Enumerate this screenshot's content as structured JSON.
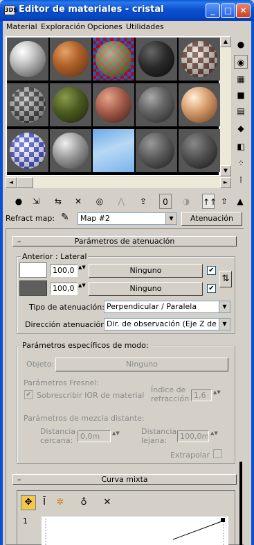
{
  "window": {
    "title": "Editor de materiales - cristal",
    "app_icon": "3DS",
    "min": "_",
    "max": "□",
    "close": "✕"
  },
  "menu": [
    "Material",
    "Exploración",
    "Opciones",
    "Utilidades"
  ],
  "icons": {
    "scroll_up": "▲",
    "scroll_down": "▼",
    "scroll_left": "◄",
    "scroll_right": "►",
    "dropdown_arrow": "▼",
    "spin": "▲▼",
    "check": "✔",
    "minus": "–"
  },
  "side_tools": [
    "●",
    "◉",
    "▦",
    "■",
    "▤",
    "◆",
    "◧",
    "⁘",
    "⁞"
  ],
  "toolbar": [
    "●",
    "⇲",
    "⇆",
    "✕",
    "◎",
    "⋀",
    "⇪",
    "0",
    "◑",
    "↑↑",
    "⇧",
    "▲"
  ],
  "refract": {
    "label": "Refract map:",
    "map": "Map #2",
    "button": "Atenuación"
  },
  "rollout1": {
    "title": "Parámetros de atenuación",
    "group_title": "Anterior : Lateral",
    "row1": {
      "color": "#ffffff",
      "amount": "100,0",
      "map": "Ninguno"
    },
    "row2": {
      "color": "#5e5e5e",
      "amount": "100,0",
      "map": "Ninguno"
    },
    "swap_icon": "⇅",
    "type_label": "Tipo de atenuación:",
    "type_value": "Perpendicular / Paralela",
    "dir_label": "Dirección atenuación:",
    "dir_value": "Dir. de observación (Eje Z de cám"
  },
  "mode": {
    "title": "Parámetros específicos de modo:",
    "object_label": "Objeto:",
    "object_value": "Ninguno",
    "fresnel_title": "Parámetros Fresnel:",
    "override": "Sobrescribir IOR de material",
    "ior_label1": "Índice de",
    "ior_label2": "refracción",
    "ior_value": "1,6",
    "blend_title": "Parámetros de mezcla distante:",
    "near1": "Distancia",
    "near2": "cercana:",
    "near_value": "0,0m",
    "far1": "Distancia",
    "far2": "lejana:",
    "far_value": "100,0m",
    "extrapolate": "Extrapolar"
  },
  "rollout2": {
    "title": "Curva mixta",
    "tools": [
      "✥",
      "Ī",
      "✲",
      "♁",
      "✕"
    ],
    "y_label": "1"
  },
  "colors": {
    "title_blue": "#0a52cf",
    "face": "#d4d0c8"
  }
}
